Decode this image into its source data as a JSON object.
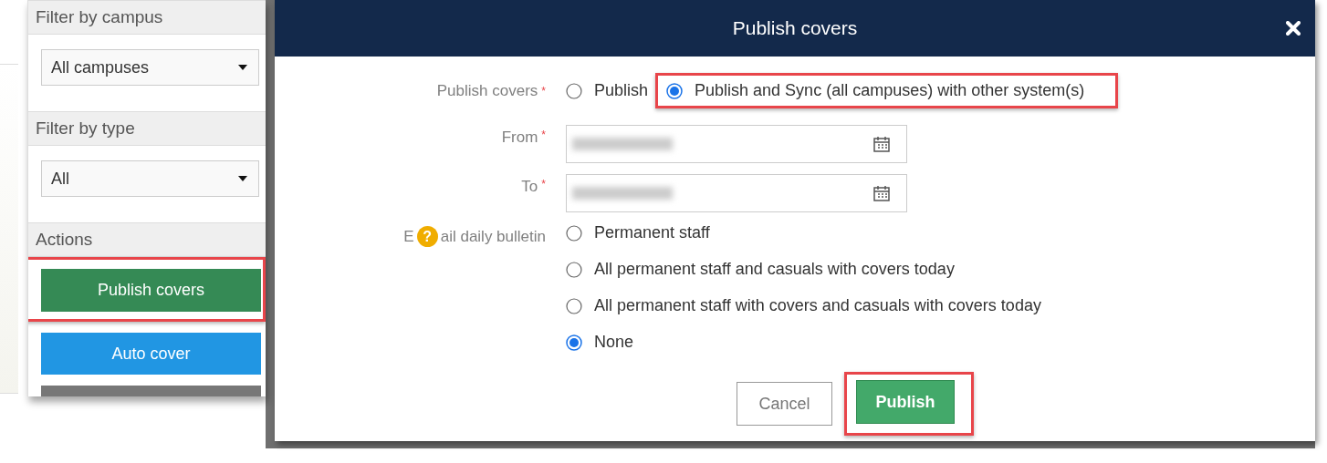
{
  "sidebar": {
    "sections": [
      {
        "title": "Filter by campus",
        "select": "All campuses"
      },
      {
        "title": "Filter by type",
        "select": "All"
      },
      {
        "title": "Actions",
        "buttons": [
          {
            "label": "Publish covers",
            "kind": "publish",
            "highlighted": true
          },
          {
            "label": "Auto cover",
            "kind": "auto",
            "highlighted": false
          },
          {
            "kind": "more",
            "highlighted": false
          }
        ]
      }
    ]
  },
  "dialog": {
    "title": "Publish covers",
    "publish_covers": {
      "label": "Publish covers",
      "required": true,
      "required_mark": "*",
      "options": [
        {
          "label": "Publish",
          "selected": false,
          "highlighted": false
        },
        {
          "label": "Publish and Sync (all campuses) with other system(s)",
          "selected": true,
          "highlighted": true
        }
      ]
    },
    "dates": [
      {
        "label": "From",
        "required": true,
        "required_mark": "*"
      },
      {
        "label": "To",
        "required": true,
        "required_mark": "*"
      }
    ],
    "email": {
      "label_before": "E",
      "help": "?",
      "label_after": "ail daily bulletin",
      "options": [
        {
          "label": "Permanent staff",
          "selected": false
        },
        {
          "label": "All permanent staff and casuals with covers today",
          "selected": false
        },
        {
          "label": "All permanent staff with covers and casuals with covers today",
          "selected": false
        },
        {
          "label": "None",
          "selected": true
        }
      ]
    },
    "buttons": [
      {
        "label": "Cancel",
        "kind": "secondary",
        "highlighted": false
      },
      {
        "label": "Publish",
        "kind": "primary",
        "highlighted": true
      }
    ]
  }
}
